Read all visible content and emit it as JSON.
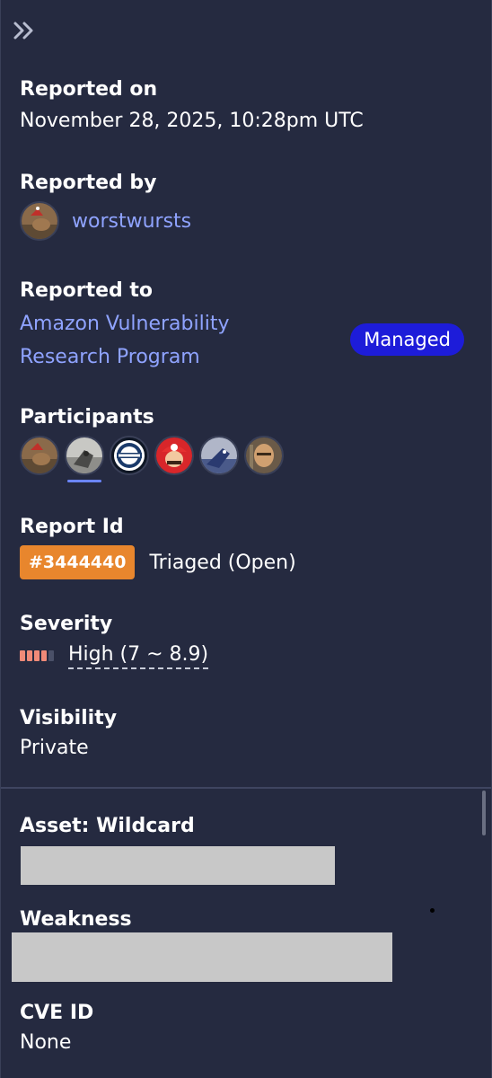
{
  "reported_on": {
    "label": "Reported on",
    "value": "November 28, 2025, 10:28pm UTC"
  },
  "reported_by": {
    "label": "Reported by",
    "username": "worstwursts"
  },
  "reported_to": {
    "label": "Reported to",
    "program_line1": "Amazon Vulnerability",
    "program_line2": "Research Program",
    "badge": "Managed"
  },
  "participants": {
    "label": "Participants",
    "avatars": [
      "reporter-avatar",
      "wolf-avatar",
      "laughing-man-avatar",
      "mario-avatar",
      "dragon-avatar",
      "warrior-avatar"
    ],
    "active_index": 1
  },
  "report": {
    "label": "Report Id",
    "id": "#3444440",
    "status": "Triaged (Open)"
  },
  "severity": {
    "label": "Severity",
    "value": "High (7 ~ 8.9)",
    "level": 4,
    "max_level": 5,
    "color": "#f08a78"
  },
  "visibility": {
    "label": "Visibility",
    "value": "Private"
  },
  "asset": {
    "label": "Asset: Wildcard"
  },
  "weakness": {
    "label": "Weakness"
  },
  "cve": {
    "label": "CVE ID",
    "value": "None"
  },
  "colors": {
    "background": "#252a40",
    "link": "#8fa3ff",
    "managed": "#1d1cd9",
    "report_badge": "#e8862d"
  }
}
